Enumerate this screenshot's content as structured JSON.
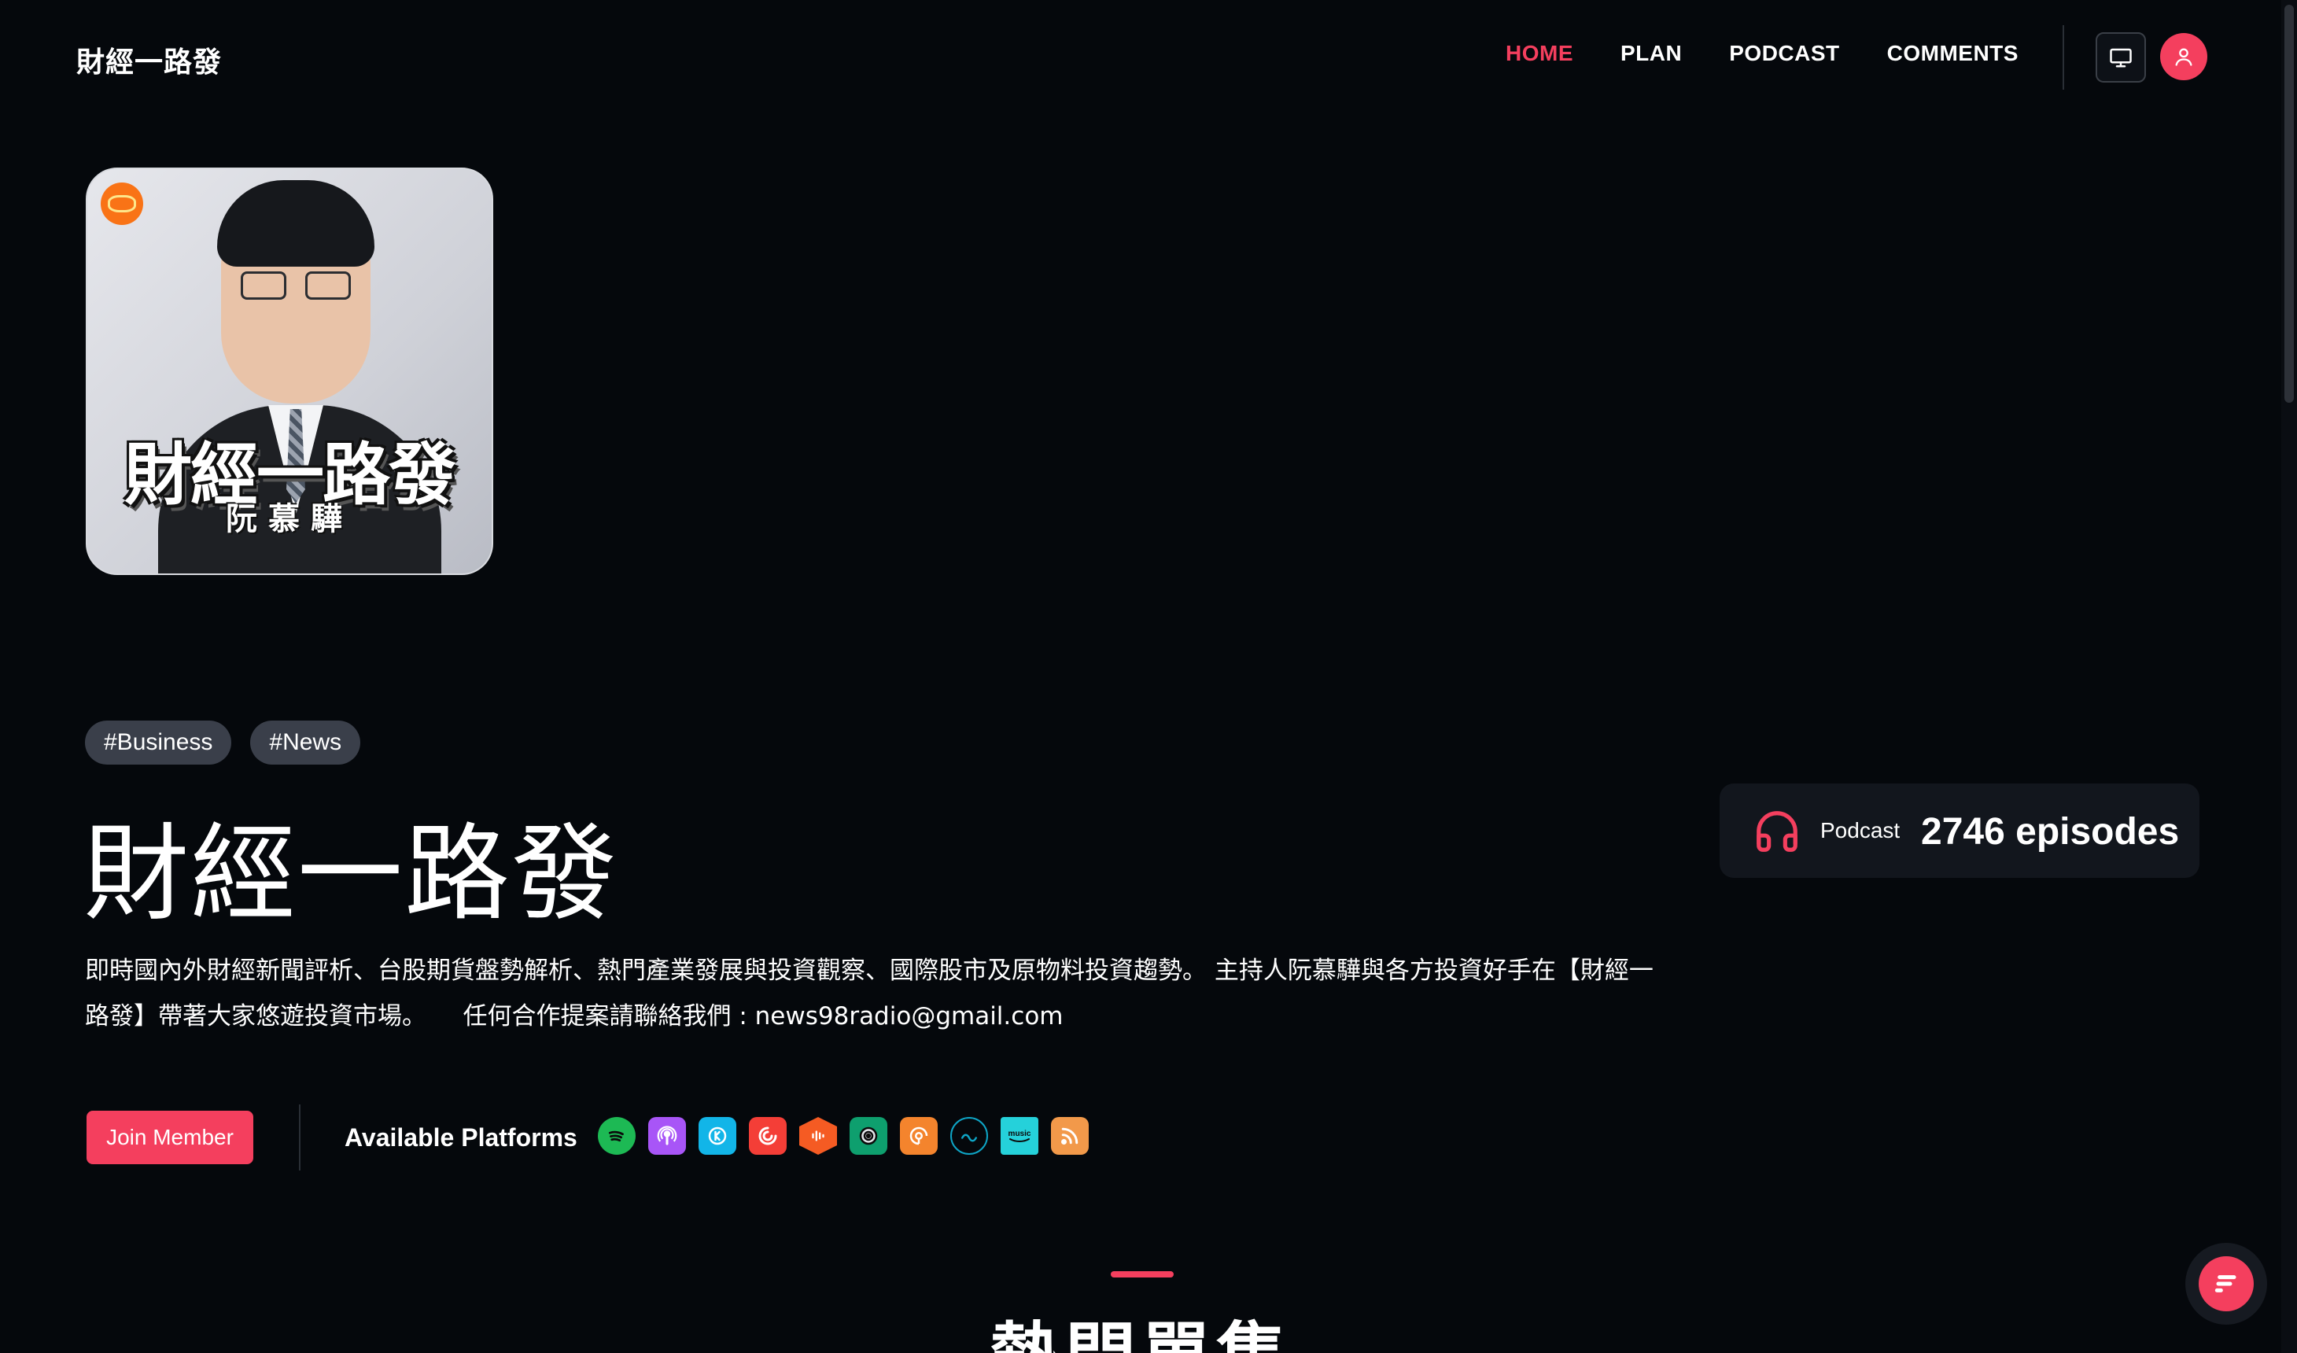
{
  "header": {
    "logo": "財經一路發",
    "nav": [
      {
        "label": "HOME",
        "active": true
      },
      {
        "label": "PLAN",
        "active": false
      },
      {
        "label": "PODCAST",
        "active": false
      },
      {
        "label": "COMMENTS",
        "active": false
      }
    ],
    "icons": {
      "display": "monitor-icon",
      "user": "user-icon"
    }
  },
  "cover": {
    "title": "財經一路發",
    "host": "阮慕驊"
  },
  "podcast": {
    "tags": [
      "#Business",
      "#News"
    ],
    "title": "財經一路發",
    "description": "即時國內外財經新聞評析、台股期貨盤勢解析、熱門產業發展與投資觀察、國際股市及原物料投資趨勢。 主持人阮慕驊與各方投資好手在【財經一路發】帶著大家悠遊投資市場。　　任何合作提案請聯絡我們 : news98radio@gmail.com",
    "join_label": "Join Member",
    "platforms_label": "Available Platforms",
    "platforms": [
      {
        "name": "spotify-icon",
        "color": "#1db954"
      },
      {
        "name": "apple-podcasts-icon",
        "color": "#a855f7"
      },
      {
        "name": "kkbox-icon",
        "color": "#12b5e8"
      },
      {
        "name": "pocket-casts-icon",
        "color": "#f43e37"
      },
      {
        "name": "castbox-icon",
        "color": "#f55b23"
      },
      {
        "name": "overcast-icon",
        "color": "#0e9f6e"
      },
      {
        "name": "podcast-addict-icon",
        "color": "#f4842d"
      },
      {
        "name": "castro-icon",
        "color": "#0ea5c6"
      },
      {
        "name": "amazon-music-icon",
        "color": "#25d1da"
      },
      {
        "name": "rss-icon",
        "color": "#f2994a"
      }
    ]
  },
  "stats": {
    "label": "Podcast",
    "value": "2746 episodes"
  },
  "section": {
    "title": "熱門單集"
  },
  "colors": {
    "accent": "#f43f5e",
    "background": "#05080c",
    "tag_bg": "#3a3f4a",
    "card_bg": "#12161d"
  }
}
